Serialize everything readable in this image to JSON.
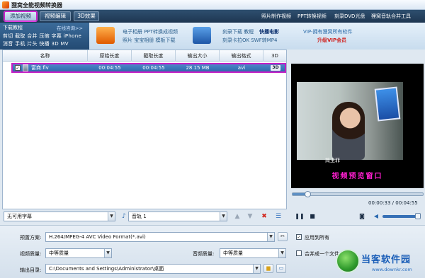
{
  "window": {
    "title": "狸窝全能视频转换器"
  },
  "menubar": {
    "tabs": [
      {
        "label": "添加视频"
      },
      {
        "label": "视频编辑"
      },
      {
        "label": "3D效果"
      }
    ],
    "links": [
      {
        "label": "照片制作视频"
      },
      {
        "label": "PPT转换视频"
      },
      {
        "label": "刻录DVD光盘"
      },
      {
        "label": "狸窝音轨合并工具"
      }
    ]
  },
  "download_panel": {
    "header": "下载教程",
    "more": "在线咨询>>",
    "row1": "剪切 截取 合并 压缩 字幕 iPhone",
    "row2": "消音 手机 片头 快播 3D MV"
  },
  "promo": {
    "block1": {
      "line1": "电子相册 PPT转换成视频",
      "line2": "照片 宝宝相册 模板下载"
    },
    "block2": {
      "line1": "刻录下载 教程",
      "hot": "快播电影",
      "line2": "刻录卡拉OK SWF转MP4"
    },
    "vip": {
      "line1": "VIP-拥有狸窝所有软件",
      "line2": "升级VIP会员"
    }
  },
  "file_list": {
    "columns": [
      "名称",
      "原始长度",
      "截取长度",
      "输出大小",
      "输出格式",
      "3D"
    ],
    "rows": [
      {
        "checked": "✓",
        "name": "富商.flv",
        "original_length": "00:04:55",
        "clip_length": "00:04:55",
        "output_size": "28.15 MB",
        "format": "avi",
        "three_d": "3D"
      }
    ]
  },
  "preview": {
    "overlay_text": "视频预览窗口",
    "subtitle_text": "简玉菲",
    "time": "00:00:33 / 00:04:55",
    "progress_fraction": 0.11
  },
  "subtitle_bar": {
    "subtitle": "无可用字幕",
    "audio": "音轨 1"
  },
  "settings": {
    "preset_label": "预置方案:",
    "preset_value": "H.264/MPEG-4 AVC Video Format(*.avi)",
    "apply_all": "应用到所有",
    "video_quality_label": "视频质量:",
    "video_quality": "中等质量",
    "audio_quality_label": "音频质量:",
    "audio_quality": "中等质量",
    "merge": "合并成一个文件",
    "output_label": "输出目录:",
    "output_path": "C:\\Documents and Settings\\Administrator\\桌面"
  },
  "watermark": {
    "brand": "当客软件园",
    "url": "www.downkr.com"
  },
  "colors": {
    "highlight": "#c41ec4",
    "row_selected": "#2f68ae",
    "overlay": "#ff1fd0"
  }
}
